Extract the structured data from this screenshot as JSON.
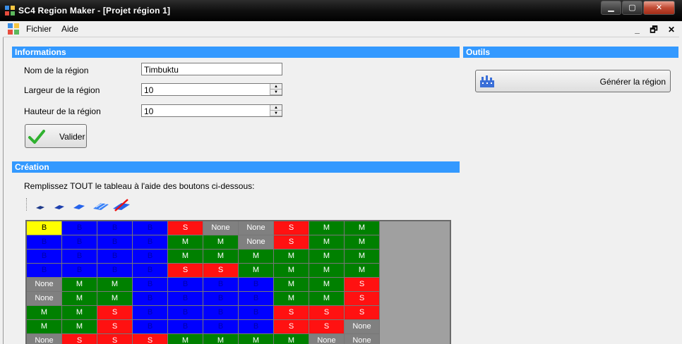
{
  "window": {
    "title": "SC4 Region Maker - [Projet région 1]"
  },
  "menu": {
    "items": [
      "Fichier",
      "Aide"
    ]
  },
  "info": {
    "header": "Informations",
    "name_label": "Nom de la région",
    "name_value": "Timbuktu",
    "width_label": "Largeur de la région",
    "width_value": "10",
    "height_label": "Hauteur de la région",
    "height_value": "10",
    "validate_label": "Valider"
  },
  "tools": {
    "header": "Outils",
    "generate_label": "Générer la région"
  },
  "creation": {
    "header": "Création",
    "instructions": "Remplissez TOUT le tableau à l'aide des boutons ci-dessous:",
    "tool_icons": [
      "small-tile-icon",
      "medium-tile-icon",
      "large-tile-icon",
      "fill-all-icon",
      "erase-icon"
    ],
    "selected_cell": [
      0,
      0
    ],
    "grid": [
      [
        "B",
        "B",
        "B",
        "B",
        "S",
        "None",
        "None",
        "S",
        "M",
        "M"
      ],
      [
        "B",
        "B",
        "B",
        "B",
        "M",
        "M",
        "None",
        "S",
        "M",
        "M"
      ],
      [
        "B",
        "B",
        "B",
        "B",
        "M",
        "M",
        "M",
        "M",
        "M",
        "M"
      ],
      [
        "B",
        "B",
        "B",
        "B",
        "S",
        "S",
        "M",
        "M",
        "M",
        "M"
      ],
      [
        "None",
        "M",
        "M",
        "B",
        "B",
        "B",
        "B",
        "M",
        "M",
        "S"
      ],
      [
        "None",
        "M",
        "M",
        "B",
        "B",
        "B",
        "B",
        "M",
        "M",
        "S"
      ],
      [
        "M",
        "M",
        "S",
        "B",
        "B",
        "B",
        "B",
        "S",
        "S",
        "S"
      ],
      [
        "M",
        "M",
        "S",
        "B",
        "B",
        "B",
        "B",
        "S",
        "S",
        "None"
      ],
      [
        "None",
        "S",
        "S",
        "S",
        "M",
        "M",
        "M",
        "M",
        "None",
        "None"
      ]
    ]
  },
  "colors": {
    "header": "#3399ff",
    "B": "#0000ff",
    "S": "#ff1111",
    "M": "#008000",
    "None": "#808080",
    "selected": "#ffff00"
  }
}
